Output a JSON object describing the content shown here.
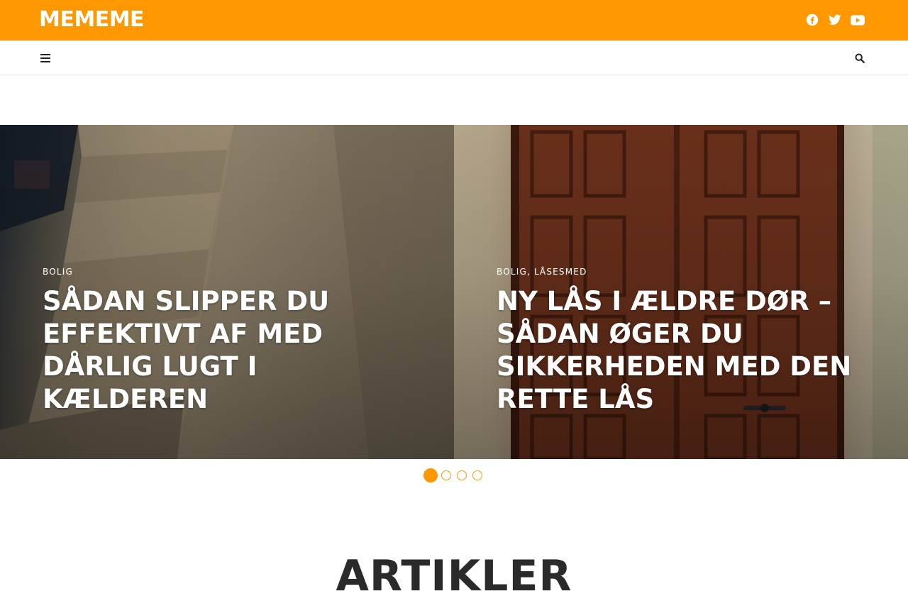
{
  "site": {
    "logo": "MEMEME",
    "accent": "#ff9800"
  },
  "header": {
    "social": [
      {
        "name": "facebook",
        "icon": "facebook-icon"
      },
      {
        "name": "twitter",
        "icon": "twitter-icon"
      },
      {
        "name": "youtube",
        "icon": "youtube-icon"
      }
    ]
  },
  "nav": {
    "menu_icon": "hamburger-icon",
    "search_icon": "search-icon"
  },
  "slider": {
    "slides": [
      {
        "categories": "BOLIG",
        "title": "SÅDAN SLIPPER DU EFFEKTIVT AF MED DÅRLIG LUGT I KÆLDEREN"
      },
      {
        "categories": "BOLIG, LÅSESMED",
        "title": "NY LÅS I ÆLDRE DØR – SÅDAN ØGER DU SIKKERHEDEN MED DEN RETTE LÅS"
      }
    ],
    "pagination": {
      "total": 4,
      "active": 1
    }
  },
  "section": {
    "title": "ARTIKLER"
  }
}
